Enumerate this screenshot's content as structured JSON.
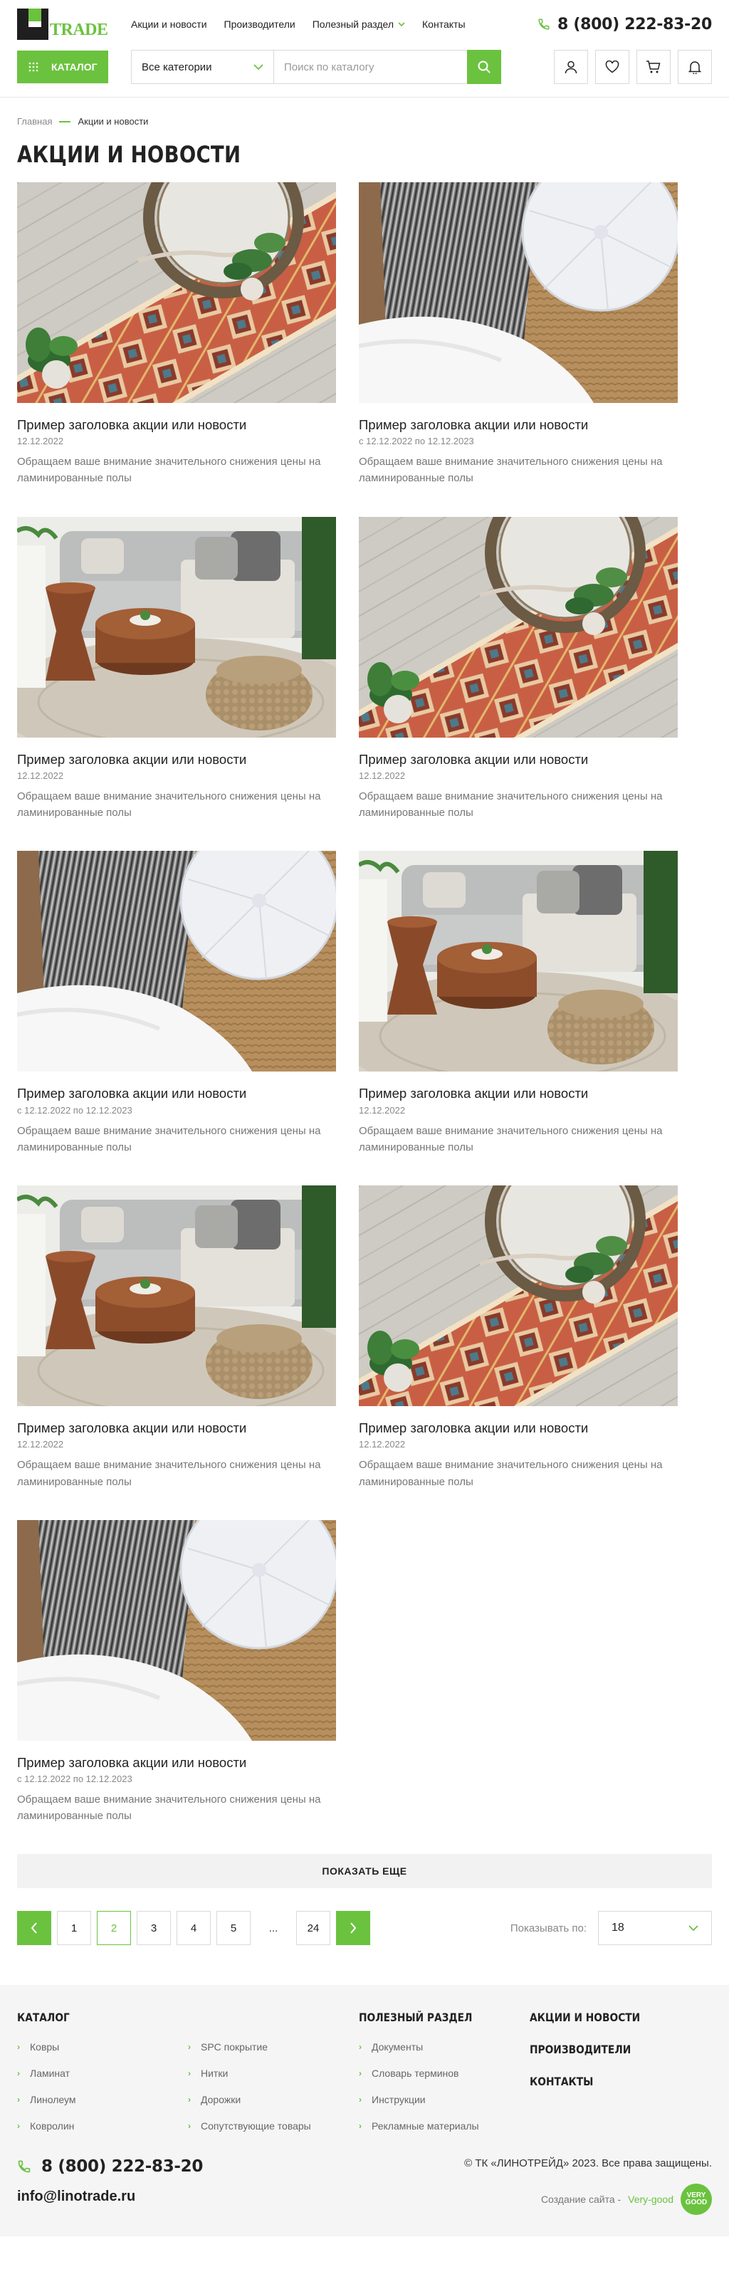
{
  "header": {
    "logo_text": "TRADE",
    "nav": [
      "Акции и новости",
      "Производители",
      "Полезный раздел",
      "Контакты"
    ],
    "phone": "8 (800) 222-83-20",
    "catalog_label": "Каталог",
    "category_select": "Все категории",
    "search_placeholder": "Поиск по каталогу"
  },
  "breadcrumbs": {
    "home": "Главная",
    "current": "Акции и новости"
  },
  "page_title": "Акции и новости",
  "news": [
    {
      "image": "rug",
      "title": "Пример заголовка акции или новости",
      "date": "12.12.2022",
      "desc": "Обращаем ваше внимание значительного снижения цены на ламинированные полы"
    },
    {
      "image": "pillow",
      "title": "Пример заголовка акции или новости",
      "date": "с 12.12.2022 по 12.12.2023",
      "desc": "Обращаем ваше внимание значительного снижения цены на ламинированные полы"
    },
    {
      "image": "sofa",
      "title": "Пример заголовка акции или новости",
      "date": "12.12.2022",
      "desc": "Обращаем ваше внимание значительного снижения цены на ламинированные полы"
    },
    {
      "image": "rug",
      "title": "Пример заголовка акции или новости",
      "date": "12.12.2022",
      "desc": "Обращаем ваше внимание значительного снижения цены на ламинированные полы"
    },
    {
      "image": "pillow",
      "title": "Пример заголовка акции или новости",
      "date": "с 12.12.2022 по 12.12.2023",
      "desc": "Обращаем ваше внимание значительного снижения цены на ламинированные полы"
    },
    {
      "image": "sofa",
      "title": "Пример заголовка акции или новости",
      "date": "12.12.2022",
      "desc": "Обращаем ваше внимание значительного снижения цены на ламинированные полы"
    },
    {
      "image": "sofa",
      "title": "Пример заголовка акции или новости",
      "date": "12.12.2022",
      "desc": "Обращаем ваше внимание значительного снижения цены на ламинированные полы"
    },
    {
      "image": "rug",
      "title": "Пример заголовка акции или новости",
      "date": "12.12.2022",
      "desc": "Обращаем ваше внимание значительного снижения цены на ламинированные полы"
    },
    {
      "image": "pillow",
      "title": "Пример заголовка акции или новости",
      "date": "с 12.12.2022 по 12.12.2023",
      "desc": "Обращаем ваше внимание значительного снижения цены на ламинированные полы"
    }
  ],
  "more_button": "Показать еще",
  "pagination": {
    "pages": [
      "1",
      "2",
      "3",
      "4",
      "5",
      "...",
      "24"
    ],
    "current": "2"
  },
  "per_page": {
    "label": "Показывать по:",
    "value": "18"
  },
  "footer": {
    "catalog_title": "Каталог",
    "catalog_col1": [
      "Ковры",
      "Ламинат",
      "Линолеум",
      "Ковролин"
    ],
    "catalog_col2": [
      "SPC покрытие",
      "Нитки",
      "Дорожки",
      "Сопутствующие товары"
    ],
    "useful_title": "Полезный раздел",
    "useful_links": [
      "Документы",
      "Словарь терминов",
      "Инструкции",
      "Рекламные материалы"
    ],
    "main_links": [
      "Акции и новости",
      "Производители",
      "Контакты"
    ],
    "phone": "8 (800) 222-83-20",
    "email": "info@linotrade.ru",
    "copyright": "© ТК «ЛИНОТРЕЙД» 2023. Все права защищены.",
    "made_by_label": "Создание сайта -",
    "made_by_link": "Very-good",
    "made_by_badge": "VERY GOOD"
  },
  "colors": {
    "accent": "#6bc23f",
    "text": "#222222",
    "muted": "#888888",
    "footer_bg": "#f5f5f5"
  }
}
